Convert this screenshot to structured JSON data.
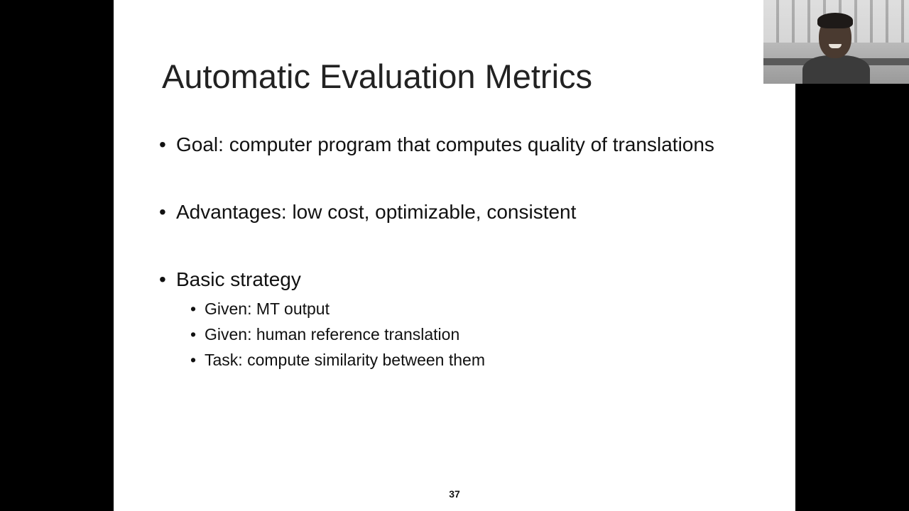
{
  "slide": {
    "title": "Automatic Evaluation Metrics",
    "bullets": [
      {
        "text": "Goal: computer program that computes quality of translations"
      },
      {
        "text": "Advantages: low cost, optimizable, consistent"
      },
      {
        "text": "Basic strategy",
        "subbullets": [
          "Given: MT output",
          "Given: human reference translation",
          "Task: compute similarity between them"
        ]
      }
    ],
    "page_number": "37",
    "bullet_glyph": "•"
  },
  "colors": {
    "background": "#000000",
    "slide": "#ffffff",
    "text": "#111111"
  }
}
